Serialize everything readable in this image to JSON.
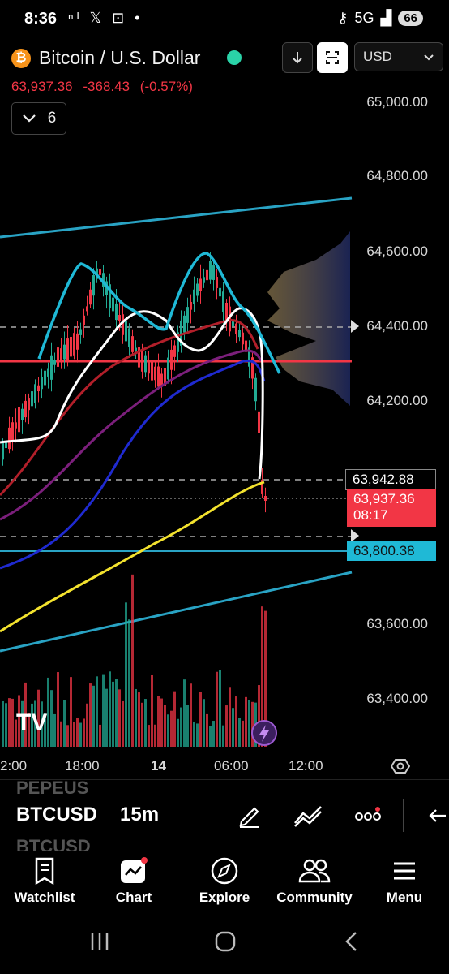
{
  "status_bar": {
    "time": "8:36",
    "notifications": "ⁿᴵ 𝕏 ⊡ •",
    "network": "5G",
    "battery": "66"
  },
  "header": {
    "logo_glyph": "₿",
    "title": "Bitcoin / U.S. Dollar",
    "currency": "USD",
    "last_price": "63,937.36",
    "change": "-368.43",
    "change_pct": "(-0.57%)",
    "indicator_count": "6"
  },
  "axis": {
    "y_labels": [
      "65,000.00",
      "64,800.00",
      "64,600.00",
      "64,400.00",
      "64,200.00",
      "63,600.00",
      "63,400.00"
    ],
    "x_labels": [
      "2:00",
      "18:00",
      "14",
      "06:00",
      "12:00"
    ],
    "tags": {
      "level": "63,942.88",
      "price": "63,937.36",
      "countdown": "08:17",
      "low": "63,800.38"
    }
  },
  "toolbar": {
    "ghost_above": "PEPEUS",
    "symbol": "BTCUSD",
    "ghost_below": "BTCUSD",
    "interval": "15m"
  },
  "nav": {
    "watchlist": "Watchlist",
    "chart": "Chart",
    "explore": "Explore",
    "community": "Community",
    "menu": "Menu"
  },
  "colors": {
    "down": "#f23645",
    "up": "#22ab94",
    "channel": "#29a3c4",
    "tag_low": "#1fb9d6"
  }
}
